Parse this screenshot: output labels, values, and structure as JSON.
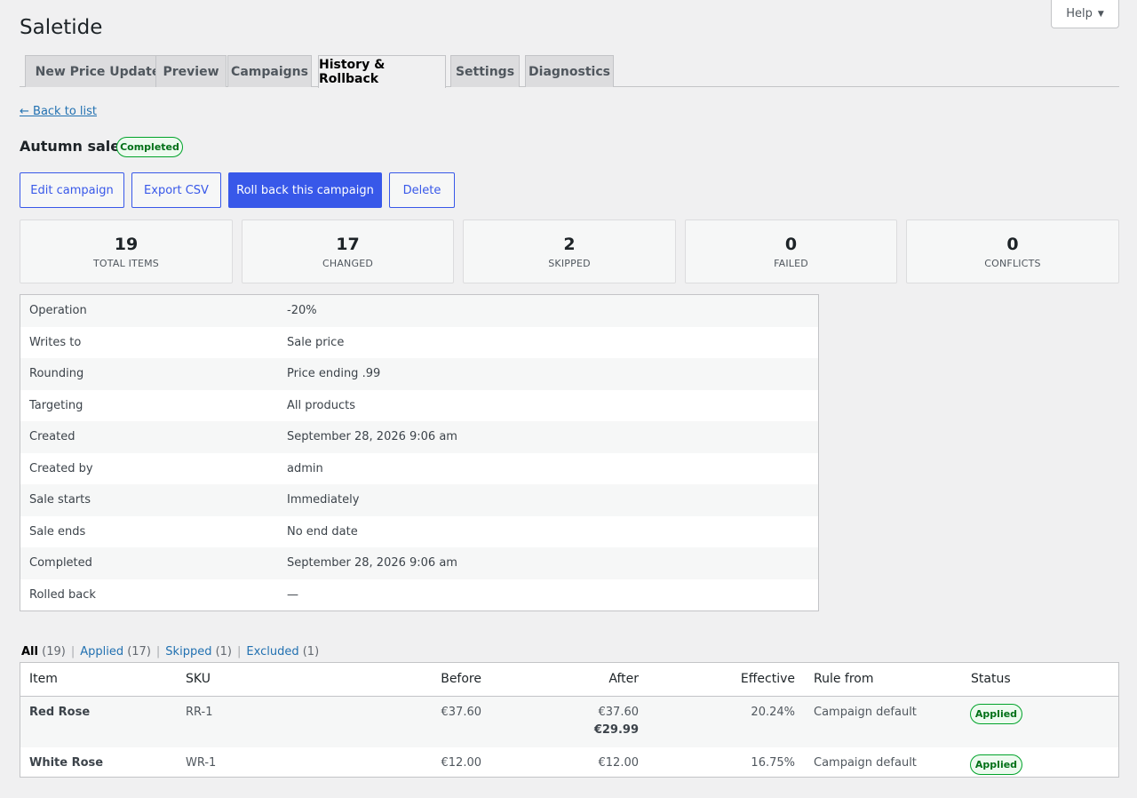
{
  "app": {
    "title": "Saletide",
    "help_label": "Help"
  },
  "tabs": [
    {
      "label": "New Price Update"
    },
    {
      "label": "Preview"
    },
    {
      "label": "Campaigns"
    },
    {
      "label": "History & Rollback"
    },
    {
      "label": "Settings"
    },
    {
      "label": "Diagnostics"
    }
  ],
  "active_tab": "History & Rollback",
  "back_link": "← Back to list",
  "campaign": {
    "name": "Autumn sale",
    "status": "Completed"
  },
  "actions": {
    "edit": "Edit campaign",
    "export": "Export CSV",
    "rollback": "Roll back this campaign",
    "delete": "Delete"
  },
  "stats": [
    {
      "value": "19",
      "label": "TOTAL ITEMS"
    },
    {
      "value": "17",
      "label": "CHANGED"
    },
    {
      "value": "2",
      "label": "SKIPPED"
    },
    {
      "value": "0",
      "label": "FAILED"
    },
    {
      "value": "0",
      "label": "CONFLICTS"
    }
  ],
  "details": [
    {
      "key": "Operation",
      "value": "-20%"
    },
    {
      "key": "Writes to",
      "value": "Sale price"
    },
    {
      "key": "Rounding",
      "value": "Price ending .99"
    },
    {
      "key": "Targeting",
      "value": "All products"
    },
    {
      "key": "Created",
      "value": "September 28, 2026 9:06 am"
    },
    {
      "key": "Created by",
      "value": "admin"
    },
    {
      "key": "Sale starts",
      "value": "Immediately"
    },
    {
      "key": "Sale ends",
      "value": "No end date"
    },
    {
      "key": "Completed",
      "value": "September 28, 2026 9:06 am"
    },
    {
      "key": "Rolled back",
      "value": "—"
    }
  ],
  "filters": {
    "all": {
      "label": "All",
      "count": "(19)"
    },
    "applied": {
      "label": "Applied",
      "count": "(17)"
    },
    "skipped": {
      "label": "Skipped",
      "count": "(1)"
    },
    "excluded": {
      "label": "Excluded",
      "count": "(1)"
    },
    "separator": "|"
  },
  "table": {
    "headers": {
      "item": "Item",
      "sku": "SKU",
      "before": "Before",
      "after": "After",
      "effective": "Effective",
      "rule": "Rule from",
      "status": "Status"
    },
    "rows": [
      {
        "item": "Red Rose",
        "sku": "RR-1",
        "before": "€37.60",
        "after_regular": "€37.60",
        "after_sale": "€29.99",
        "effective": "20.24%",
        "rule": "Campaign default",
        "status": "Applied"
      },
      {
        "item": "White Rose",
        "sku": "WR-1",
        "before": "€12.00",
        "after_regular": "€12.00",
        "after_sale": "",
        "effective": "16.75%",
        "rule": "Campaign default",
        "status": "Applied"
      }
    ]
  },
  "colors": {
    "accent": "#3858e9",
    "link": "#2271b1",
    "success_border": "#00a32a",
    "success_text": "#007017",
    "background": "#f0f0f1"
  }
}
